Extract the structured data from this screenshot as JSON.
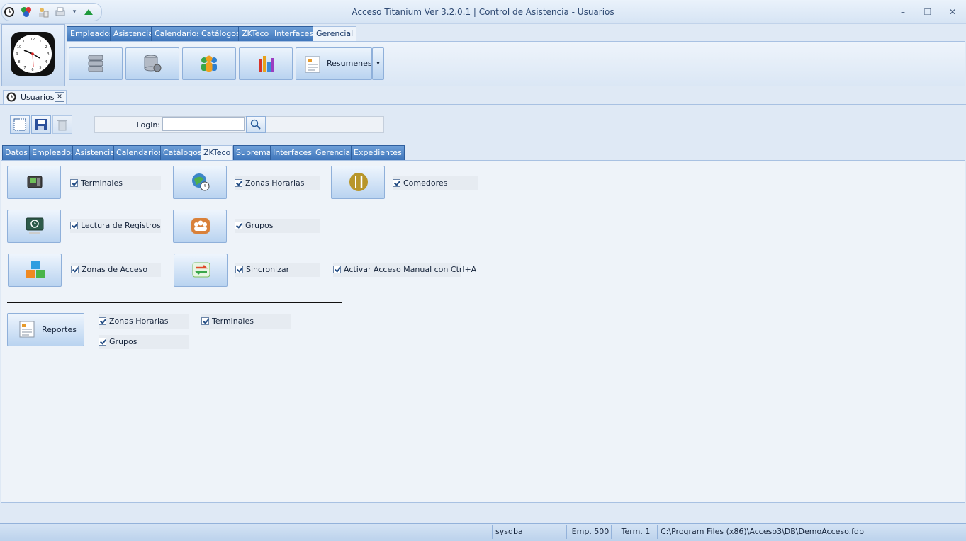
{
  "window": {
    "title": "Acceso Titanium  Ver 3.2.0.1 | Control de Asistencia - Usuarios",
    "minimize": "–",
    "restore": "❐",
    "close": "✕"
  },
  "ribbon": {
    "tabs": [
      "Empleados",
      "Asistencia",
      "Calendarios",
      "Catálogos",
      "ZKTeco",
      "Interfaces",
      "Gerencial"
    ],
    "active_tab": "Gerencial",
    "resumenes_label": "Resumenes",
    "dropdown_glyph": "▾"
  },
  "document_tab": {
    "label": "Usuarios",
    "close": "✕"
  },
  "toolbar": {
    "login_label": "Login:",
    "login_value": ""
  },
  "inner_tabs": [
    "Datos",
    "Empleados",
    "Asistencia",
    "Calendarios",
    "Catálogos",
    "ZKTeco",
    "Suprema",
    "Interfaces",
    "Gerencial",
    "Expedientes"
  ],
  "inner_active": "ZKTeco",
  "permissions": {
    "terminales": "Terminales",
    "zonas_horarias": "Zonas Horarias",
    "comedores": "Comedores",
    "lectura_registros": "Lectura de Registros",
    "grupos": "Grupos",
    "zonas_acceso": "Zonas de Acceso",
    "sincronizar": "Sincronizar",
    "acceso_manual": "Activar Acceso Manual con Ctrl+A"
  },
  "reportes": {
    "button_label": "Reportes",
    "zonas_horarias": "Zonas Horarias",
    "terminales": "Terminales",
    "grupos": "Grupos"
  },
  "status": {
    "user": "sysdba",
    "emp": "Emp. 500",
    "term": "Term. 1",
    "db_path": "C:\\Program Files (x86)\\Acceso3\\DB\\DemoAcceso.fdb"
  }
}
